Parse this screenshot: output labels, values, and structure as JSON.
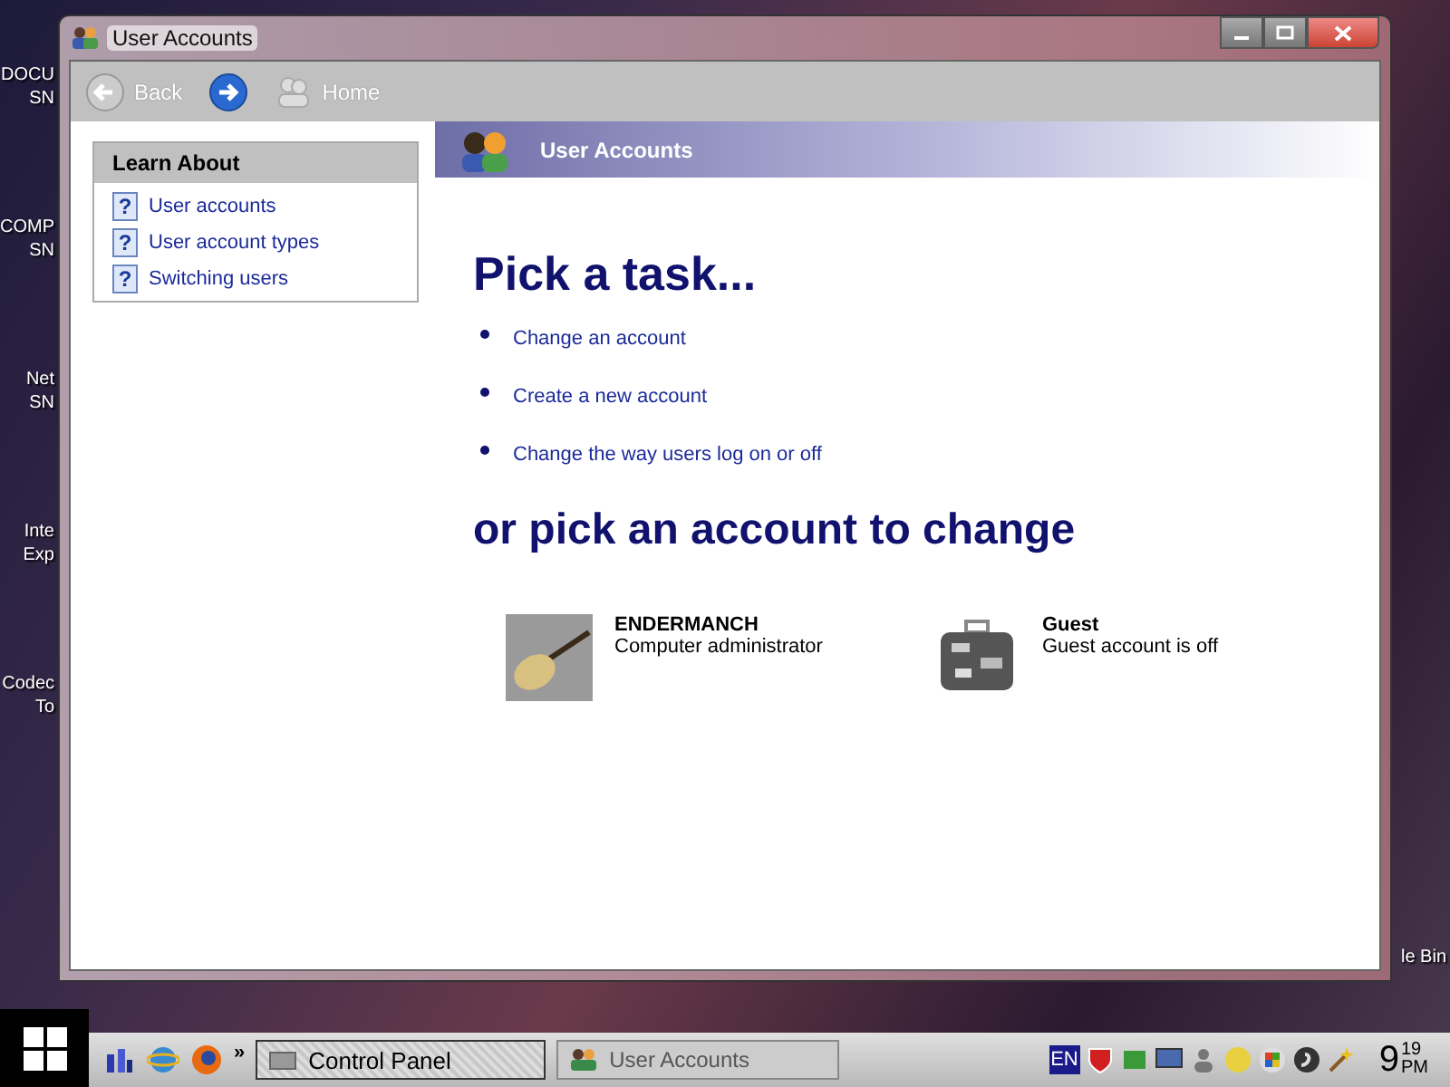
{
  "desktop_icons": [
    {
      "label": "DOCU SN"
    },
    {
      "label": "COMP SN"
    },
    {
      "label": "Net SN"
    },
    {
      "label": "Inte Exp"
    },
    {
      "label": "Codec To"
    }
  ],
  "desktop_icons_right": [
    {
      "label": "le Bin"
    }
  ],
  "window": {
    "title": "User Accounts"
  },
  "toolbar": {
    "back": {
      "label": "Back",
      "disabled": true
    },
    "forward": {
      "disabled": false
    },
    "home": {
      "label": "Home",
      "disabled": true
    }
  },
  "learn_about": {
    "title": "Learn About",
    "items": [
      {
        "icon": "?",
        "label": "User accounts"
      },
      {
        "icon": "?",
        "label": "User account types"
      },
      {
        "icon": "?",
        "label": "Switching users"
      }
    ]
  },
  "banner": {
    "title": "User Accounts"
  },
  "tasks": {
    "heading": "Pick a task...",
    "items": [
      {
        "label": "Change an account"
      },
      {
        "label": "Create a new account"
      },
      {
        "label": "Change the way users log on or off"
      }
    ]
  },
  "accounts": {
    "heading": "or pick an account to change",
    "items": [
      {
        "kind": "guitar",
        "name": "ENDERMANCH",
        "type": "Computer administrator"
      },
      {
        "kind": "suitcase",
        "name": "Guest",
        "type": "Guest account is off"
      }
    ]
  },
  "taskbar": {
    "overflow": "»",
    "tasks": [
      {
        "label": "Control Panel",
        "selected": true
      },
      {
        "label": "User Accounts",
        "selected": false
      }
    ],
    "language": "EN",
    "clock": {
      "hour": "9",
      "minute": "19",
      "ampm": "PM"
    }
  }
}
